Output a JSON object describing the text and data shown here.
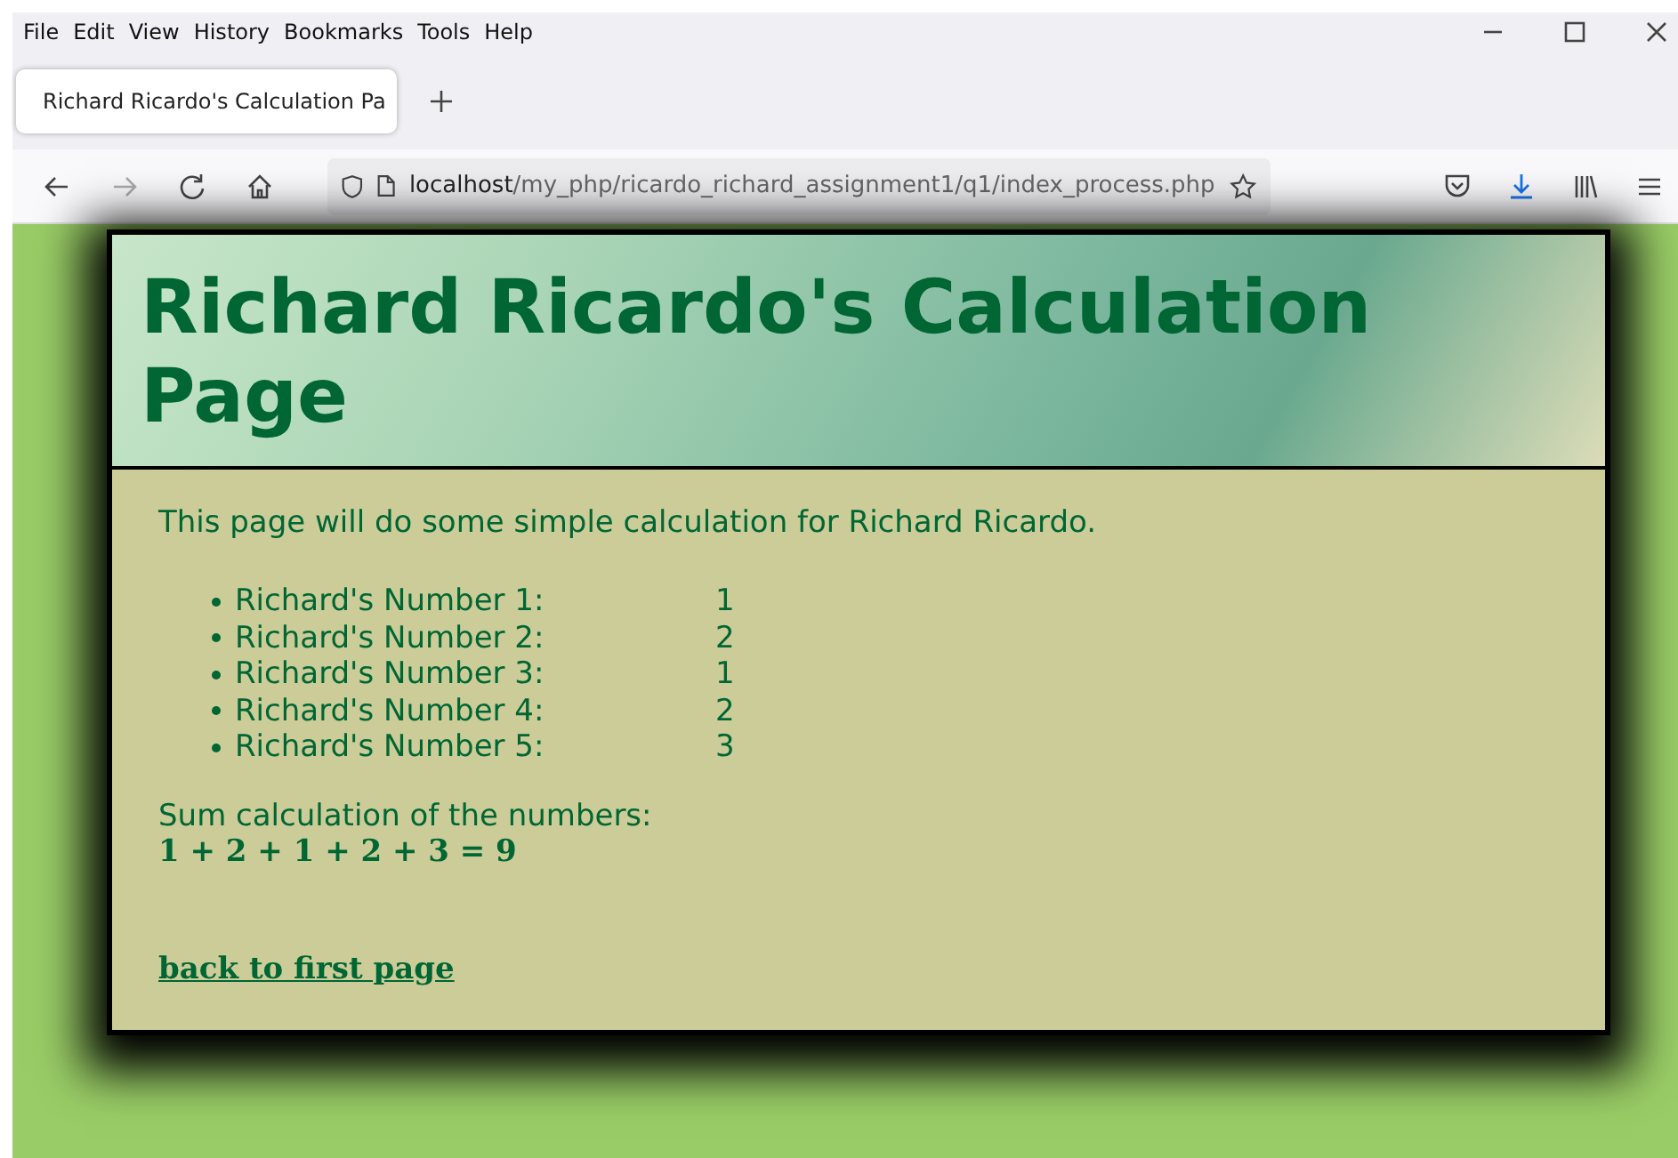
{
  "menu": [
    "File",
    "Edit",
    "View",
    "History",
    "Bookmarks",
    "Tools",
    "Help"
  ],
  "tabs": [
    {
      "title": "Richard Ricardo's Calculation Pa",
      "selected": true
    }
  ],
  "address_bar": {
    "host": "localhost",
    "path": "/my_php/ricardo_richard_assignment1/q1/index_process.php"
  },
  "page": {
    "heading": "Richard Ricardo's Calculation Page",
    "intro": "This page will do some simple calculation for Richard Ricardo.",
    "numbers": [
      {
        "label": "Richard's Number 1:",
        "value": "1"
      },
      {
        "label": "Richard's Number 2:",
        "value": "2"
      },
      {
        "label": "Richard's Number 3:",
        "value": "1"
      },
      {
        "label": "Richard's Number 4:",
        "value": "2"
      },
      {
        "label": "Richard's Number 5:",
        "value": "3"
      }
    ],
    "sum_label": "Sum calculation of the numbers:",
    "sum_expression": "1 + 2 + 1 + 2 + 3 = 9",
    "link": "back to first page"
  }
}
